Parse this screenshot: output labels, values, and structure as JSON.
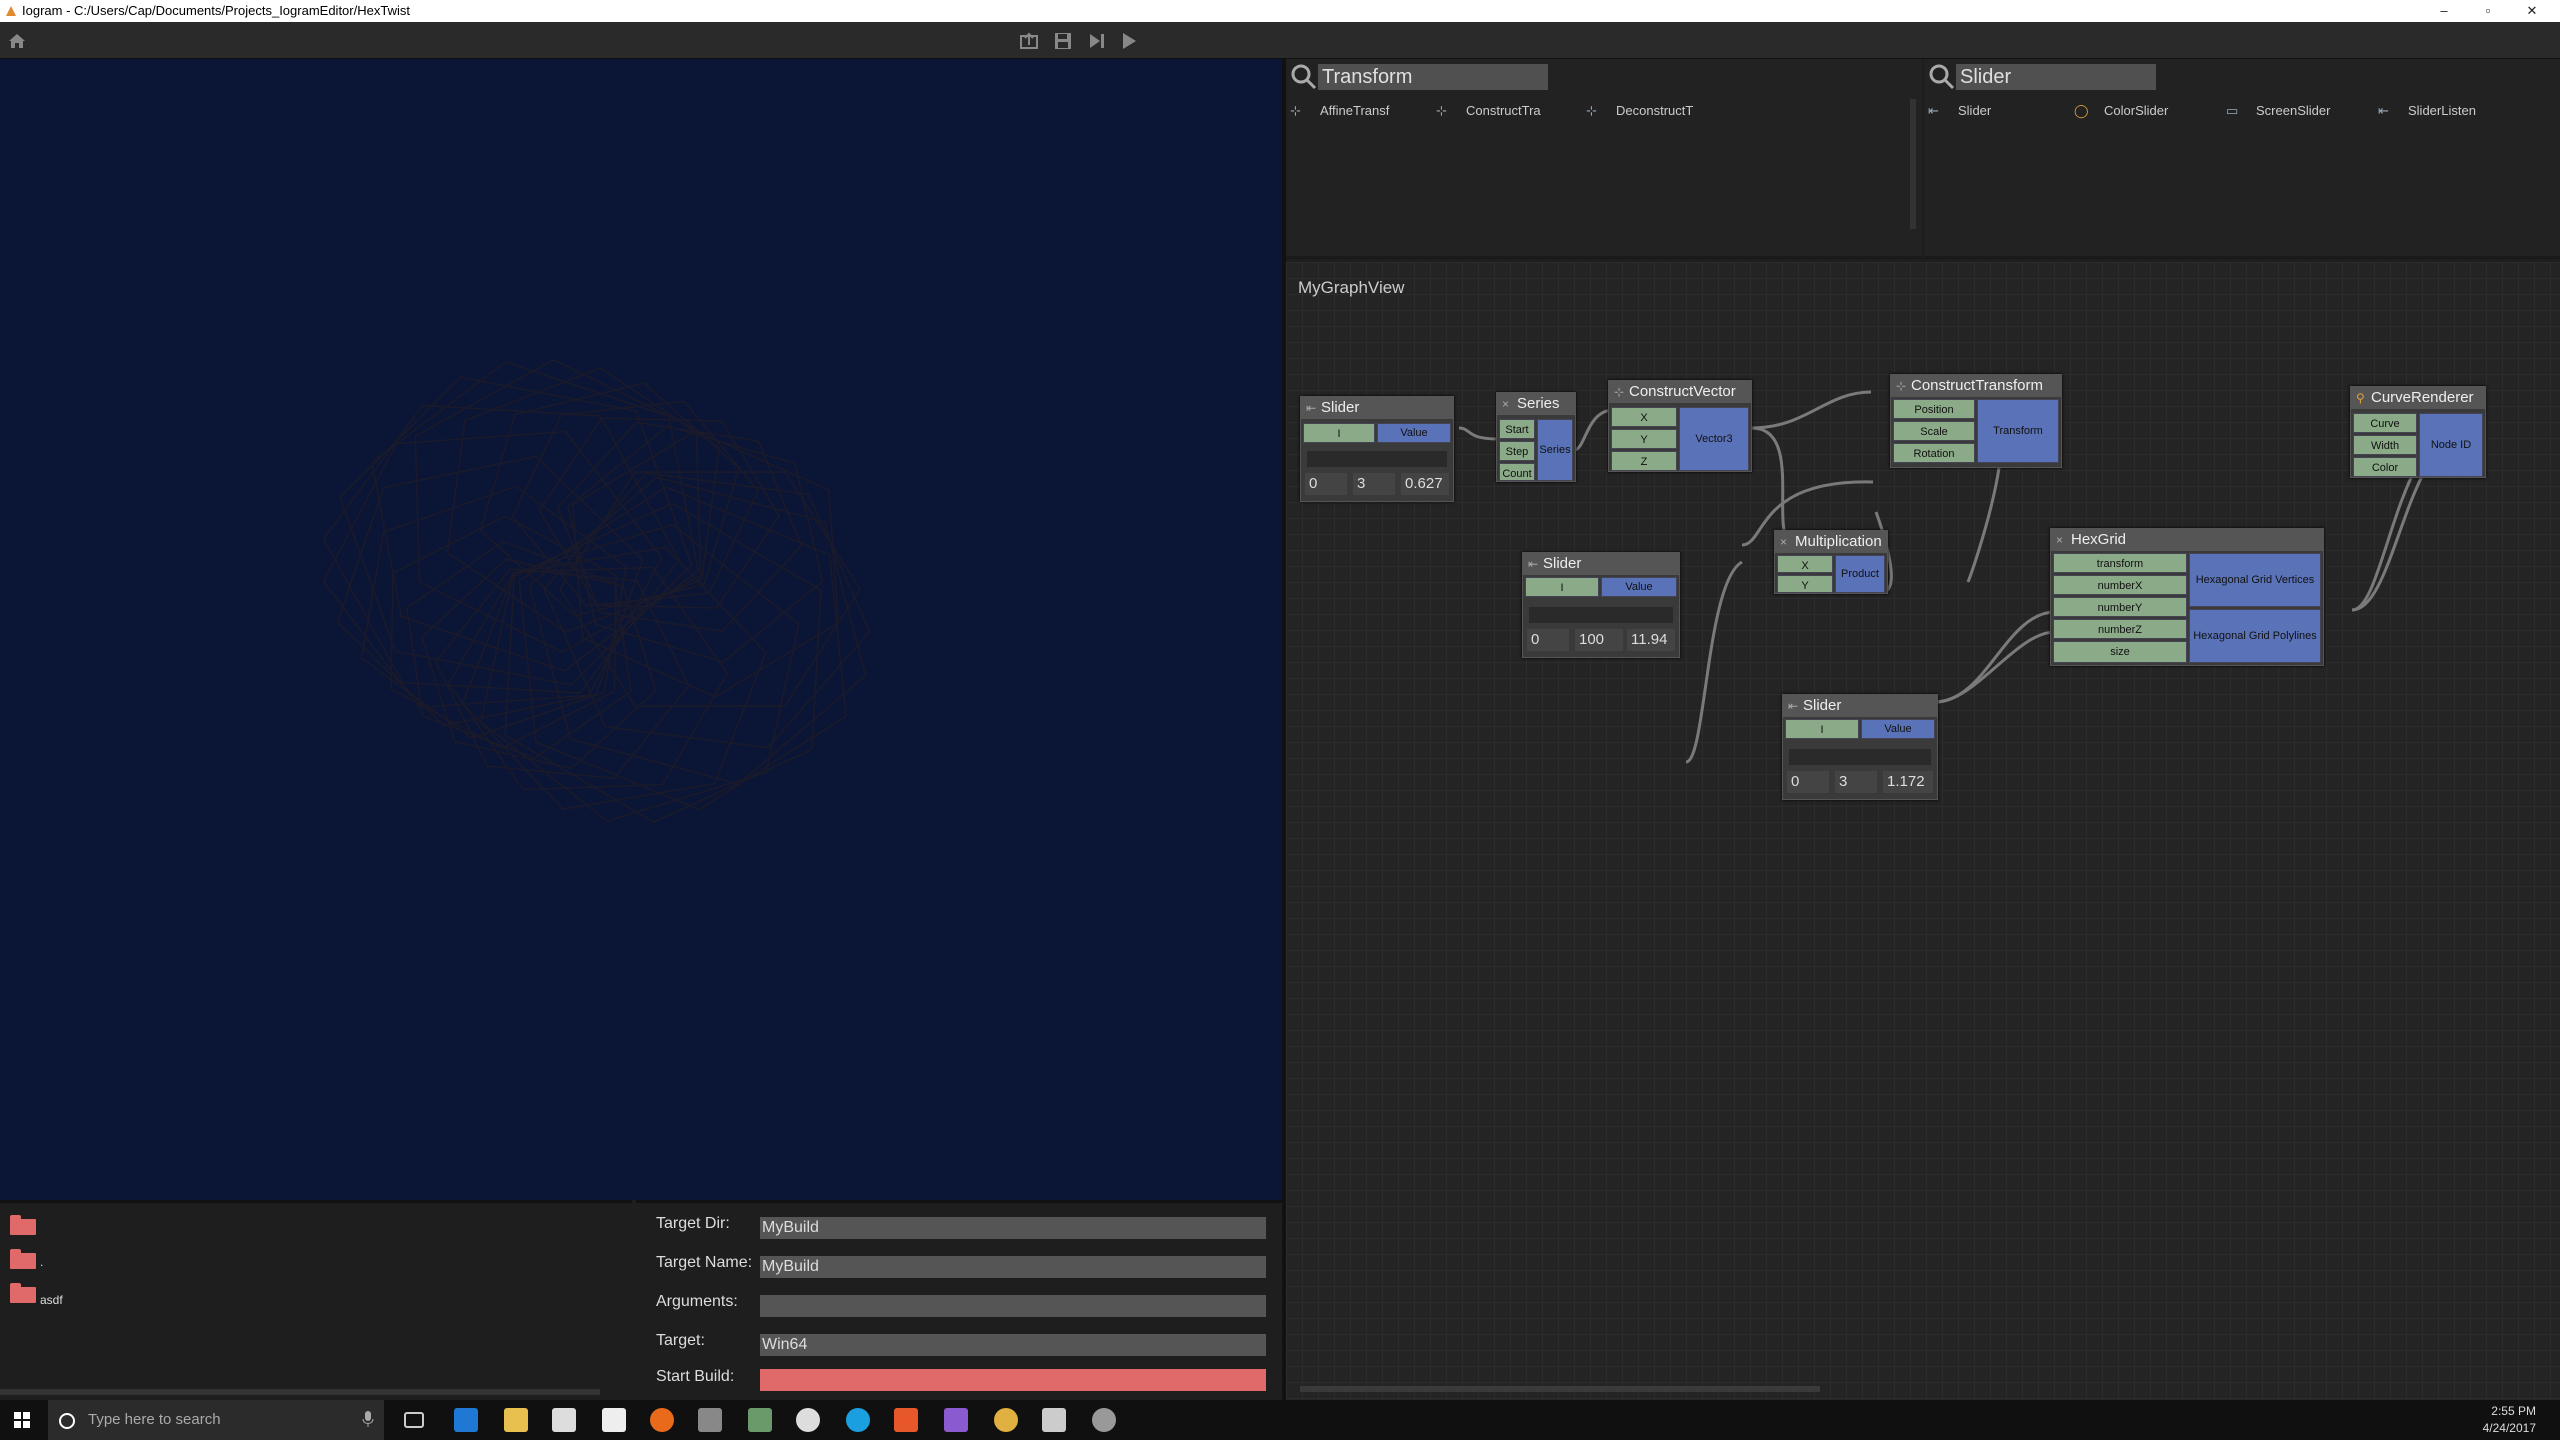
{
  "window": {
    "title": "Iogram - C:/Users/Cap/Documents/Projects_IogramEditor/HexTwist",
    "min": "–",
    "max": "▫",
    "close": "✕"
  },
  "search_left": {
    "query": "Transform",
    "results": [
      "AffineTransf",
      "ConstructTra",
      "DeconstructT"
    ]
  },
  "search_right": {
    "query": "Slider",
    "results": [
      "Slider",
      "ColorSlider",
      "ScreenSlider",
      "SliderListen"
    ]
  },
  "graph": {
    "title": "MyGraphView",
    "slider1": {
      "title": "Slider",
      "in": "I",
      "out": "Value",
      "min": "0",
      "steps": "3",
      "value": "0.627"
    },
    "series": {
      "title": "Series",
      "inputs": [
        "Start",
        "Step",
        "Count"
      ],
      "out": "Series"
    },
    "construct_vector": {
      "title": "ConstructVector",
      "inputs": [
        "X",
        "Y",
        "Z"
      ],
      "out": "Vector3"
    },
    "construct_transform": {
      "title": "ConstructTransform",
      "inputs": [
        "Position",
        "Scale",
        "Rotation"
      ],
      "out": "Transform"
    },
    "curve_renderer": {
      "title": "CurveRenderer",
      "inputs": [
        "Curve",
        "Width",
        "Color"
      ],
      "out": "Node ID"
    },
    "slider2": {
      "title": "Slider",
      "in": "I",
      "out": "Value",
      "min": "0",
      "steps": "100",
      "value": "11.94"
    },
    "multiplication": {
      "title": "Multiplication",
      "inputs": [
        "X",
        "Y"
      ],
      "out": "Product"
    },
    "hexgrid": {
      "title": "HexGrid",
      "inputs": [
        "transform",
        "numberX",
        "numberY",
        "numberZ",
        "size"
      ],
      "outputs": [
        "Hexagonal Grid Vertices",
        "Hexagonal Grid Polylines"
      ]
    },
    "slider3": {
      "title": "Slider",
      "in": "I",
      "out": "Value",
      "min": "0",
      "steps": "3",
      "value": "1.172"
    }
  },
  "assets": {
    "folders": [
      "",
      ".",
      "asdf"
    ]
  },
  "build": {
    "target_dir_label": "Target Dir:",
    "target_dir": "MyBuild",
    "target_name_label": "Target Name:",
    "target_name": "MyBuild",
    "arguments_label": "Arguments:",
    "arguments": "",
    "target_label": "Target:",
    "target": "Win64",
    "start_label": "Start Build:"
  },
  "taskbar": {
    "search_placeholder": "Type here to search",
    "time": "2:55 PM",
    "date": "4/24/2017"
  },
  "colors": {
    "viewport_bg": "#0b1535",
    "accent_red": "#e06a6a",
    "port_in": "#8aaa88",
    "port_out": "#5a72b8"
  },
  "icons": [
    "home-icon",
    "export-icon",
    "save-icon",
    "step-icon",
    "play-icon",
    "search-icon",
    "folder-icon",
    "windows-icon",
    "mic-icon"
  ]
}
